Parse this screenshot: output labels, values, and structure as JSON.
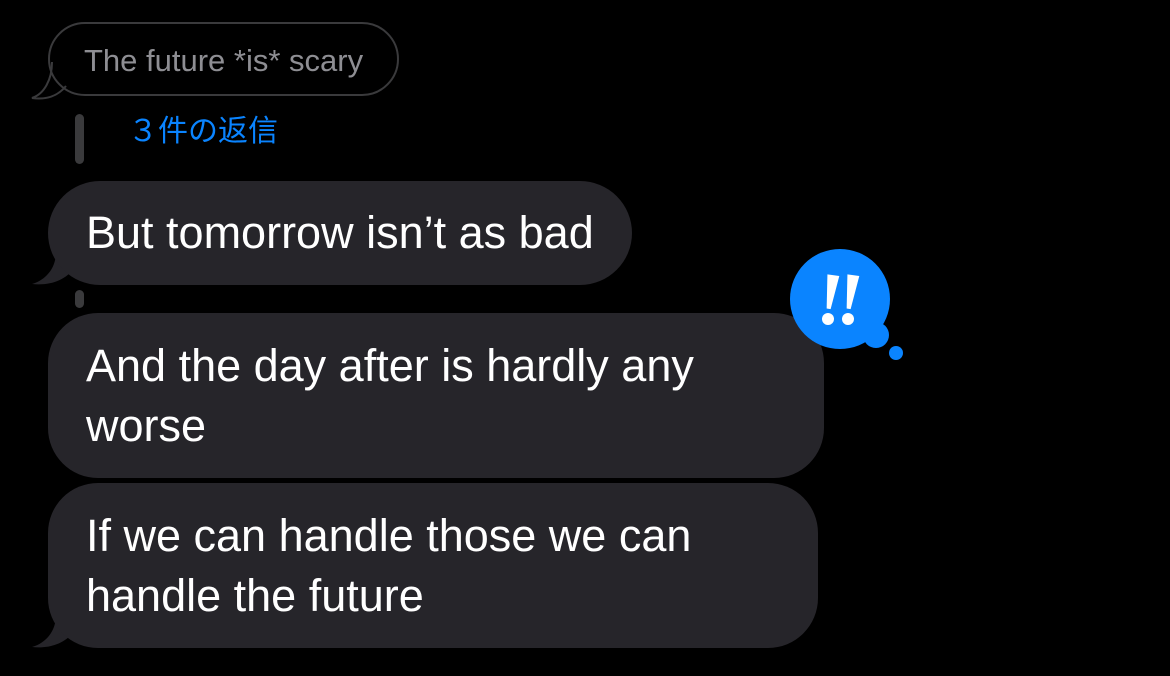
{
  "quoted_message": {
    "text": "The future *is* scary"
  },
  "thread": {
    "replies_label": "３件の返信"
  },
  "messages": [
    {
      "text": "But tomorrow isn’t as bad"
    },
    {
      "text": "And the day after is hardly any worse"
    },
    {
      "text": "If we can handle those we can handle the future"
    }
  ],
  "tapback": {
    "icon": "double-exclamation-icon",
    "glyph": "!!",
    "color": "#0a84ff"
  },
  "colors": {
    "background": "#000000",
    "bubble": "#26252a",
    "accent": "#0a84ff",
    "muted_text": "#8e8e93"
  }
}
